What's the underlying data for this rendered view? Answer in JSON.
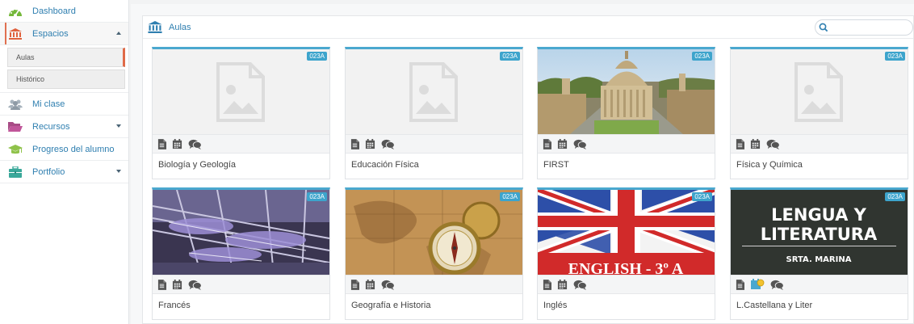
{
  "sidebar": {
    "items": [
      {
        "label": "Dashboard",
        "icon": "dashboard-gauge-icon"
      },
      {
        "label": "Espacios",
        "icon": "institution-icon"
      },
      {
        "label": "Mi clase",
        "icon": "users-icon"
      },
      {
        "label": "Recursos",
        "icon": "folder-open-icon"
      },
      {
        "label": "Progreso del alumno",
        "icon": "graduation-cap-icon"
      },
      {
        "label": "Portfolio",
        "icon": "briefcase-icon"
      }
    ],
    "espacios_sub": [
      {
        "label": "Aulas"
      },
      {
        "label": "Histórico"
      }
    ]
  },
  "header": {
    "title": "Aulas",
    "search_placeholder": ""
  },
  "cards": [
    {
      "title": "Biología y Geología",
      "badge": "023A",
      "image": "placeholder"
    },
    {
      "title": "Educación Física",
      "badge": "023A",
      "image": "placeholder"
    },
    {
      "title": "FIRST",
      "badge": "023A",
      "image": "oxford-photo"
    },
    {
      "title": "Física y Química",
      "badge": "023A",
      "image": "placeholder"
    },
    {
      "title": "Francés",
      "badge": "023A",
      "image": "steel-structure-photo"
    },
    {
      "title": "Geografía e Historia",
      "badge": "023A",
      "image": "compass-map-photo"
    },
    {
      "title": "Inglés",
      "badge": "023A",
      "image": "union-jack-photo",
      "image_caption": "ENGLISH - 3º A"
    },
    {
      "title": "L.Castellana y Liter",
      "badge": "023A",
      "image": "chalkboard-photo",
      "image_text": [
        "LENGUA Y",
        "LITERATURA",
        "SRTA. MARINA"
      ]
    }
  ],
  "colors": {
    "accent": "#2f7fb0",
    "card_top_border": "#4aa8cf",
    "badge": "#3da4cc",
    "selected_marker": "#e06a48"
  }
}
